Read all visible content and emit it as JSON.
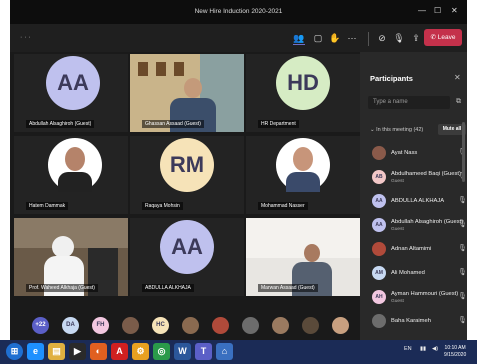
{
  "window": {
    "title": "New Hire Induction 2020-2021",
    "minimize_icon": "—",
    "restore_icon": "☐",
    "close_icon": "✕"
  },
  "toolbar": {
    "timer": "· · ·",
    "leave_label": "Leave",
    "colors": {
      "leave": "#c4314b",
      "accent": "#6b6fc9"
    }
  },
  "tiles": [
    {
      "name": "Abdullah Alsaghiroh (Guest)",
      "initials": "AA",
      "avatar_color": "#bfc1ee",
      "kind": "avatar"
    },
    {
      "name": "Ghassan Assaad (Guest)",
      "initials": "",
      "avatar_color": "",
      "kind": "video-office"
    },
    {
      "name": "HR Department",
      "initials": "HD",
      "avatar_color": "#d6ecc4",
      "kind": "avatar"
    },
    {
      "name": "Hatem Dammak",
      "initials": "",
      "avatar_color": "#ffffff",
      "kind": "photo"
    },
    {
      "name": "Raqaya Mohsin",
      "initials": "RM",
      "avatar_color": "#f6e3b8",
      "kind": "avatar"
    },
    {
      "name": "Mohammad Nasser",
      "initials": "",
      "avatar_color": "#ffffff",
      "kind": "photo"
    },
    {
      "name": "Prof. Waheed Alkhaja (Guest)",
      "initials": "",
      "avatar_color": "",
      "kind": "video-desk"
    },
    {
      "name": "ABDULLA ALKHAJA",
      "initials": "AA",
      "avatar_color": "#bfc1ee",
      "kind": "avatar"
    },
    {
      "name": "Marwan Assaad (Guest)",
      "initials": "",
      "avatar_color": "",
      "kind": "video-room"
    }
  ],
  "strip": [
    {
      "label": "+22",
      "color": "#5b5fc7"
    },
    {
      "label": "DA",
      "color": "#c7d9f2"
    },
    {
      "label": "FH",
      "color": "#f2c7e0"
    },
    {
      "label": "",
      "color": "#7a5c4a"
    },
    {
      "label": "HC",
      "color": "#f6e3b8"
    },
    {
      "label": "",
      "color": "#8a6a50"
    },
    {
      "label": "",
      "color": "#b04a3a"
    },
    {
      "label": "",
      "color": "#6c6c6c"
    },
    {
      "label": "",
      "color": "#9a7a60"
    },
    {
      "label": "",
      "color": "#5a4a3a"
    },
    {
      "label": "",
      "color": "#c8a080"
    }
  ],
  "panel": {
    "title": "Participants",
    "search_placeholder": "Type a name",
    "in_meeting": "In this meeting (42)",
    "mute_all": "Mute all",
    "participants": [
      {
        "name": "Ayat Nass",
        "sub": "",
        "initials": "",
        "color": "#8a5a4a"
      },
      {
        "name": "Abdulhameed Baqi (Guest)",
        "sub": "Guest",
        "initials": "AB",
        "color": "#f2c7c7"
      },
      {
        "name": "ABDULLA ALKHAJA",
        "sub": "",
        "initials": "AA",
        "color": "#bfc1ee"
      },
      {
        "name": "Abdullah Alsaghiroh (Guest)",
        "sub": "Guest",
        "initials": "AA",
        "color": "#bfc1ee"
      },
      {
        "name": "Adnan Altamimi",
        "sub": "",
        "initials": "",
        "color": "#b04a3a"
      },
      {
        "name": "Ali Mohamed",
        "sub": "",
        "initials": "AM",
        "color": "#c7d9f2"
      },
      {
        "name": "Ayman Hammouri (Guest)",
        "sub": "Guest",
        "initials": "AH",
        "color": "#f2c7e0"
      },
      {
        "name": "Baha Karaimeh",
        "sub": "",
        "initials": "",
        "color": "#6c6c6c"
      }
    ]
  },
  "taskbar": {
    "apps": [
      {
        "glyph": "◉",
        "color": "#1f6fd1"
      },
      {
        "glyph": "e",
        "color": "#1e90ff"
      },
      {
        "glyph": "▤",
        "color": "#e0b040"
      },
      {
        "glyph": "▶",
        "color": "#2a2a2a"
      },
      {
        "glyph": "◐",
        "color": "#e06020"
      },
      {
        "glyph": "A",
        "color": "#d02020"
      },
      {
        "glyph": "⚙",
        "color": "#e8a020"
      },
      {
        "glyph": "◎",
        "color": "#2a9a4a"
      },
      {
        "glyph": "W",
        "color": "#2b579a"
      },
      {
        "glyph": "T",
        "color": "#5b5fc7"
      },
      {
        "glyph": "⌂",
        "color": "#3a70c0"
      }
    ],
    "lang": "EN",
    "time": "10:10 AM",
    "date": "9/15/2020"
  }
}
